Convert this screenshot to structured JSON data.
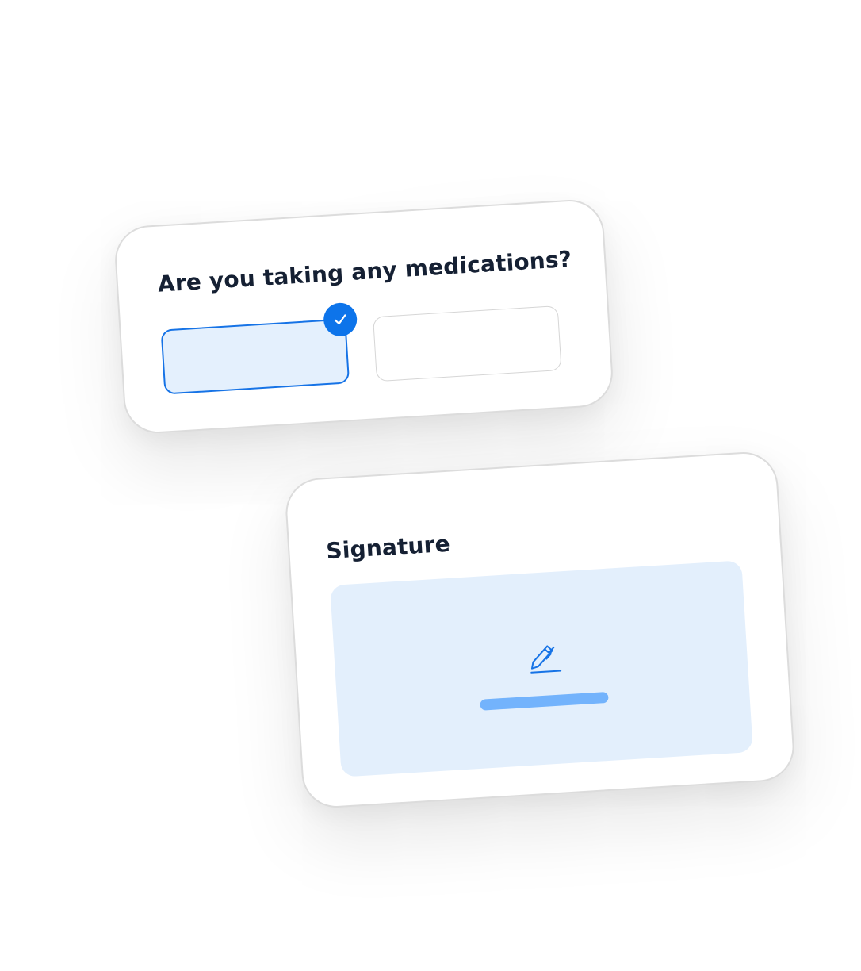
{
  "question_card": {
    "title": "Are you taking any medications?",
    "options": [
      {
        "selected": true
      },
      {
        "selected": false
      }
    ]
  },
  "signature_card": {
    "title": "Signature"
  },
  "icons": {
    "selected_check": "check-icon",
    "signature_pad": "pen-icon"
  },
  "colors": {
    "accent": "#0d74ea",
    "selected_fill": "#e4f0fd",
    "pad_fill": "#e3effc",
    "placeholder_bar": "#73b3fc",
    "text": "#152033",
    "border": "#dcdcdc"
  }
}
